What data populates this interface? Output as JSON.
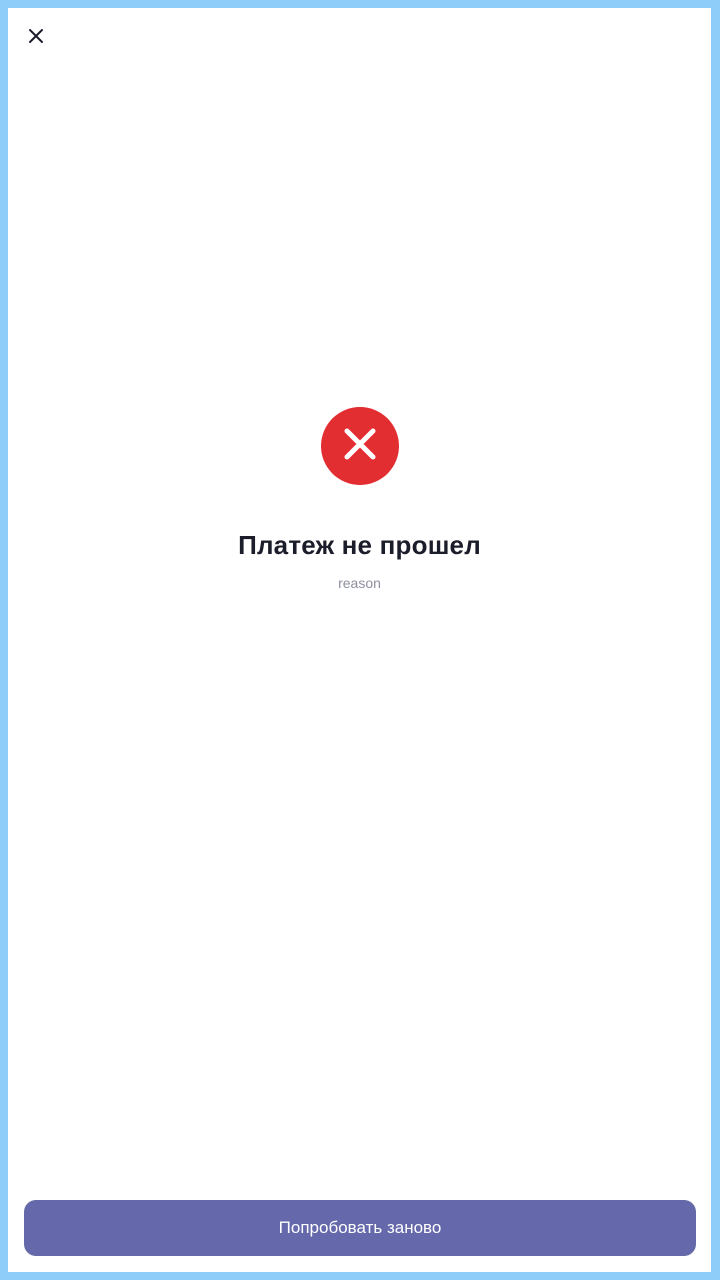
{
  "header": {
    "close_icon": "close-icon"
  },
  "status": {
    "icon": "error-cross-icon",
    "icon_color": "#e22d31",
    "title": "Платеж не прошел",
    "reason": "reason"
  },
  "actions": {
    "retry_label": "Попробовать заново",
    "retry_color": "#6569ab"
  }
}
